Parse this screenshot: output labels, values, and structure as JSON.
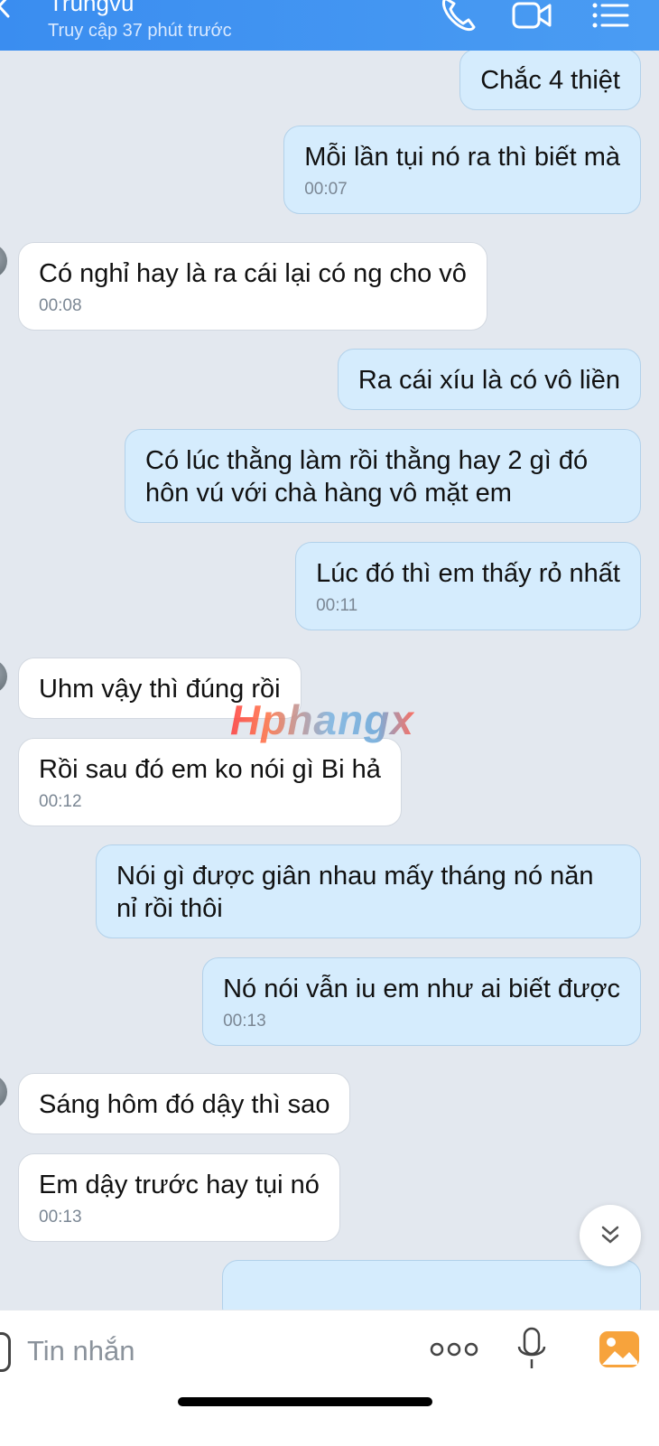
{
  "header": {
    "name": "Trungvu",
    "status": "Truy cập 37 phút trước",
    "icons": [
      "back-icon",
      "phone-icon",
      "video-call-icon",
      "menu-list-icon"
    ]
  },
  "messages": [
    {
      "dir": "out",
      "text": "Chắc 4 thiệt",
      "time": ""
    },
    {
      "dir": "out",
      "text": "Mỗi lần tụi nó ra thì biết mà",
      "time": "00:07"
    },
    {
      "dir": "in",
      "text": "Có nghỉ hay là ra cái lại có ng cho vô",
      "time": "00:08"
    },
    {
      "dir": "out",
      "text": "Ra cái xíu là có vô liền",
      "time": ""
    },
    {
      "dir": "out",
      "text": "Có lúc thằng làm rồi thằng hay 2 gì đó hôn vú với chà hàng vô mặt em",
      "time": ""
    },
    {
      "dir": "out",
      "text": "Lúc đó thì em thấy rỏ nhất",
      "time": "00:11"
    },
    {
      "dir": "in",
      "text": "Uhm vậy thì đúng rồi",
      "time": ""
    },
    {
      "dir": "in",
      "text": "Rồi sau đó em ko nói gì Bi hả",
      "time": "00:12"
    },
    {
      "dir": "out",
      "text": "Nói gì được giân nhau mấy tháng nó năn nỉ rồi thôi",
      "time": ""
    },
    {
      "dir": "out",
      "text": "Nó nói vẫn iu em như ai biết được",
      "time": "00:13"
    },
    {
      "dir": "in",
      "text": "Sáng hôm đó dậy thì sao",
      "time": ""
    },
    {
      "dir": "in",
      "text": "Em dậy trước hay tụi nó",
      "time": "00:13"
    }
  ],
  "watermark": "Hphangx",
  "composer": {
    "placeholder": "Tin nhắn",
    "icons": [
      "more-icon",
      "mic-icon",
      "image-icon"
    ]
  },
  "colors": {
    "header": "#3a8df0",
    "outgoing_bubble": "#d5ecfd",
    "incoming_bubble": "#ffffff",
    "background": "#e3e8ef"
  }
}
